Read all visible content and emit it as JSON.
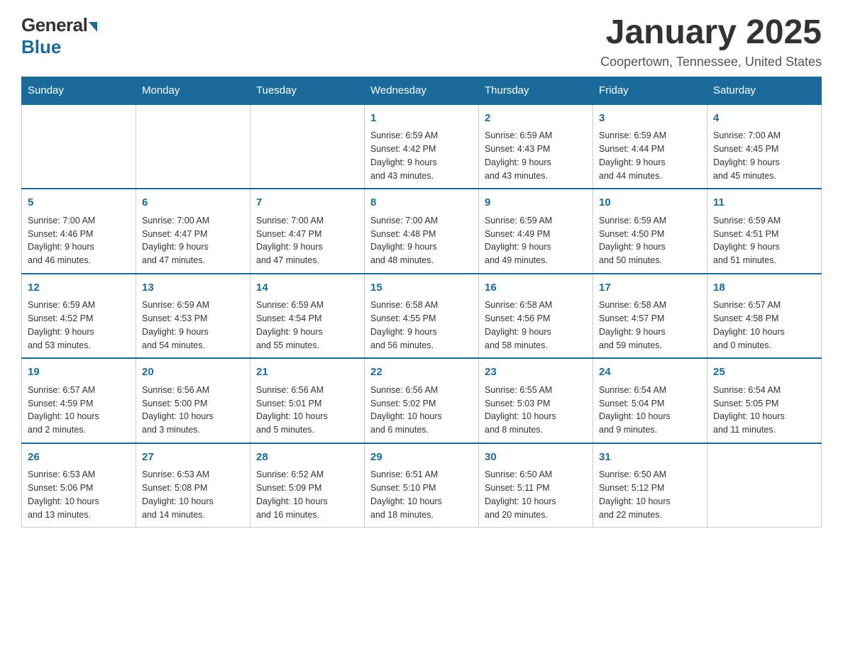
{
  "logo": {
    "general": "General",
    "blue": "Blue"
  },
  "title": "January 2025",
  "location": "Coopertown, Tennessee, United States",
  "days_header": [
    "Sunday",
    "Monday",
    "Tuesday",
    "Wednesday",
    "Thursday",
    "Friday",
    "Saturday"
  ],
  "weeks": [
    [
      {
        "day": "",
        "info": ""
      },
      {
        "day": "",
        "info": ""
      },
      {
        "day": "",
        "info": ""
      },
      {
        "day": "1",
        "info": "Sunrise: 6:59 AM\nSunset: 4:42 PM\nDaylight: 9 hours\nand 43 minutes."
      },
      {
        "day": "2",
        "info": "Sunrise: 6:59 AM\nSunset: 4:43 PM\nDaylight: 9 hours\nand 43 minutes."
      },
      {
        "day": "3",
        "info": "Sunrise: 6:59 AM\nSunset: 4:44 PM\nDaylight: 9 hours\nand 44 minutes."
      },
      {
        "day": "4",
        "info": "Sunrise: 7:00 AM\nSunset: 4:45 PM\nDaylight: 9 hours\nand 45 minutes."
      }
    ],
    [
      {
        "day": "5",
        "info": "Sunrise: 7:00 AM\nSunset: 4:46 PM\nDaylight: 9 hours\nand 46 minutes."
      },
      {
        "day": "6",
        "info": "Sunrise: 7:00 AM\nSunset: 4:47 PM\nDaylight: 9 hours\nand 47 minutes."
      },
      {
        "day": "7",
        "info": "Sunrise: 7:00 AM\nSunset: 4:47 PM\nDaylight: 9 hours\nand 47 minutes."
      },
      {
        "day": "8",
        "info": "Sunrise: 7:00 AM\nSunset: 4:48 PM\nDaylight: 9 hours\nand 48 minutes."
      },
      {
        "day": "9",
        "info": "Sunrise: 6:59 AM\nSunset: 4:49 PM\nDaylight: 9 hours\nand 49 minutes."
      },
      {
        "day": "10",
        "info": "Sunrise: 6:59 AM\nSunset: 4:50 PM\nDaylight: 9 hours\nand 50 minutes."
      },
      {
        "day": "11",
        "info": "Sunrise: 6:59 AM\nSunset: 4:51 PM\nDaylight: 9 hours\nand 51 minutes."
      }
    ],
    [
      {
        "day": "12",
        "info": "Sunrise: 6:59 AM\nSunset: 4:52 PM\nDaylight: 9 hours\nand 53 minutes."
      },
      {
        "day": "13",
        "info": "Sunrise: 6:59 AM\nSunset: 4:53 PM\nDaylight: 9 hours\nand 54 minutes."
      },
      {
        "day": "14",
        "info": "Sunrise: 6:59 AM\nSunset: 4:54 PM\nDaylight: 9 hours\nand 55 minutes."
      },
      {
        "day": "15",
        "info": "Sunrise: 6:58 AM\nSunset: 4:55 PM\nDaylight: 9 hours\nand 56 minutes."
      },
      {
        "day": "16",
        "info": "Sunrise: 6:58 AM\nSunset: 4:56 PM\nDaylight: 9 hours\nand 58 minutes."
      },
      {
        "day": "17",
        "info": "Sunrise: 6:58 AM\nSunset: 4:57 PM\nDaylight: 9 hours\nand 59 minutes."
      },
      {
        "day": "18",
        "info": "Sunrise: 6:57 AM\nSunset: 4:58 PM\nDaylight: 10 hours\nand 0 minutes."
      }
    ],
    [
      {
        "day": "19",
        "info": "Sunrise: 6:57 AM\nSunset: 4:59 PM\nDaylight: 10 hours\nand 2 minutes."
      },
      {
        "day": "20",
        "info": "Sunrise: 6:56 AM\nSunset: 5:00 PM\nDaylight: 10 hours\nand 3 minutes."
      },
      {
        "day": "21",
        "info": "Sunrise: 6:56 AM\nSunset: 5:01 PM\nDaylight: 10 hours\nand 5 minutes."
      },
      {
        "day": "22",
        "info": "Sunrise: 6:56 AM\nSunset: 5:02 PM\nDaylight: 10 hours\nand 6 minutes."
      },
      {
        "day": "23",
        "info": "Sunrise: 6:55 AM\nSunset: 5:03 PM\nDaylight: 10 hours\nand 8 minutes."
      },
      {
        "day": "24",
        "info": "Sunrise: 6:54 AM\nSunset: 5:04 PM\nDaylight: 10 hours\nand 9 minutes."
      },
      {
        "day": "25",
        "info": "Sunrise: 6:54 AM\nSunset: 5:05 PM\nDaylight: 10 hours\nand 11 minutes."
      }
    ],
    [
      {
        "day": "26",
        "info": "Sunrise: 6:53 AM\nSunset: 5:06 PM\nDaylight: 10 hours\nand 13 minutes."
      },
      {
        "day": "27",
        "info": "Sunrise: 6:53 AM\nSunset: 5:08 PM\nDaylight: 10 hours\nand 14 minutes."
      },
      {
        "day": "28",
        "info": "Sunrise: 6:52 AM\nSunset: 5:09 PM\nDaylight: 10 hours\nand 16 minutes."
      },
      {
        "day": "29",
        "info": "Sunrise: 6:51 AM\nSunset: 5:10 PM\nDaylight: 10 hours\nand 18 minutes."
      },
      {
        "day": "30",
        "info": "Sunrise: 6:50 AM\nSunset: 5:11 PM\nDaylight: 10 hours\nand 20 minutes."
      },
      {
        "day": "31",
        "info": "Sunrise: 6:50 AM\nSunset: 5:12 PM\nDaylight: 10 hours\nand 22 minutes."
      },
      {
        "day": "",
        "info": ""
      }
    ]
  ]
}
